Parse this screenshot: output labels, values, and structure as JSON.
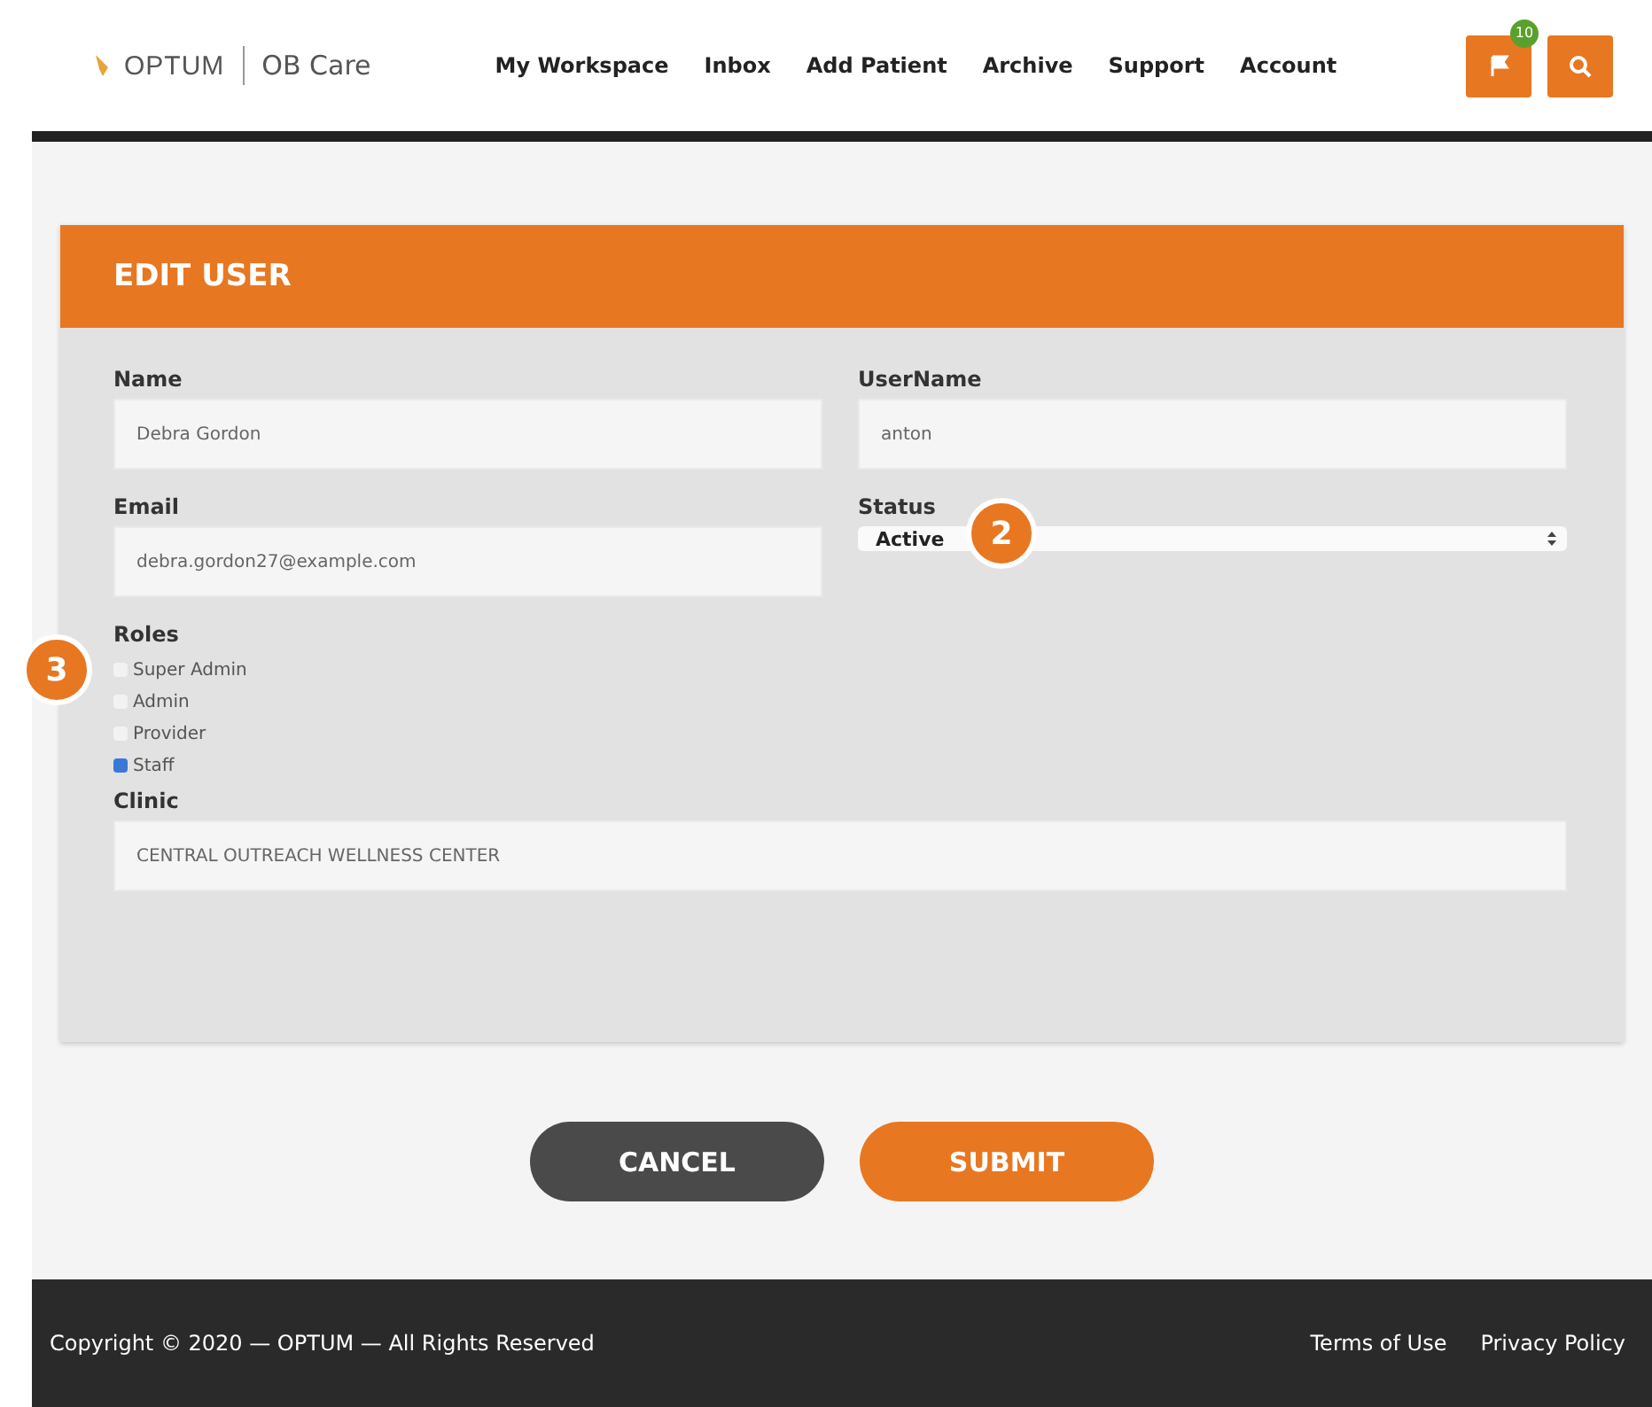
{
  "header": {
    "logo": "OPTUM",
    "product": "OB Care",
    "nav": [
      "My Workspace",
      "Inbox",
      "Add Patient",
      "Archive",
      "Support",
      "Account"
    ],
    "notification_count": "10"
  },
  "form": {
    "title": "EDIT USER",
    "name": {
      "label": "Name",
      "value": "Debra Gordon"
    },
    "username": {
      "label": "UserName",
      "value": "anton"
    },
    "email": {
      "label": "Email",
      "value": "debra.gordon27@example.com"
    },
    "status": {
      "label": "Status",
      "value": "Active"
    },
    "roles": {
      "label": "Roles",
      "items": [
        {
          "label": "Super Admin",
          "checked": false
        },
        {
          "label": "Admin",
          "checked": false
        },
        {
          "label": "Provider",
          "checked": false
        },
        {
          "label": "Staff",
          "checked": true
        }
      ]
    },
    "clinic": {
      "label": "Clinic",
      "value": "CENTRAL OUTREACH WELLNESS CENTER"
    }
  },
  "buttons": [
    {
      "label": "CANCEL",
      "kind": "secondary"
    },
    {
      "label": "SUBMIT",
      "kind": "primary"
    }
  ],
  "callouts": [
    "2",
    "3"
  ],
  "footer": {
    "copyright": "Copyright © 2020 — OPTUM — All Rights Reserved",
    "links": [
      "Terms of Use",
      "Privacy Policy"
    ]
  }
}
